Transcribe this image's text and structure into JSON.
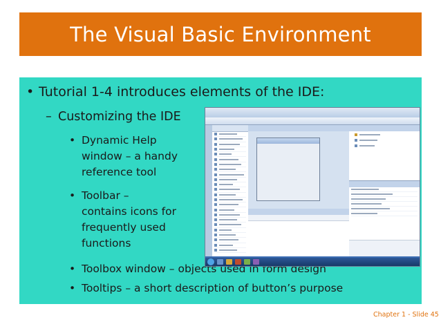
{
  "title": "The Visual Basic Environment",
  "colors": {
    "header": "#e0720e",
    "content": "#32d8c4",
    "footer_accent": "#e0720e"
  },
  "bullets": {
    "level1": "Tutorial 1-4 introduces elements of the IDE:",
    "level2": "Customizing the IDE",
    "level3": [
      {
        "lines": [
          "Dynamic Help",
          "window – a handy",
          "reference tool"
        ]
      },
      {
        "lines": [
          "Toolbar –",
          "contains icons for",
          "frequently used",
          "functions"
        ]
      },
      {
        "lines": [
          "Toolbox window – objects used in form design"
        ]
      },
      {
        "lines": [
          "Tooltips – a short description of button’s purpose"
        ]
      }
    ]
  },
  "footer": {
    "slide_number": "Chapter 1 - Slide 45"
  }
}
